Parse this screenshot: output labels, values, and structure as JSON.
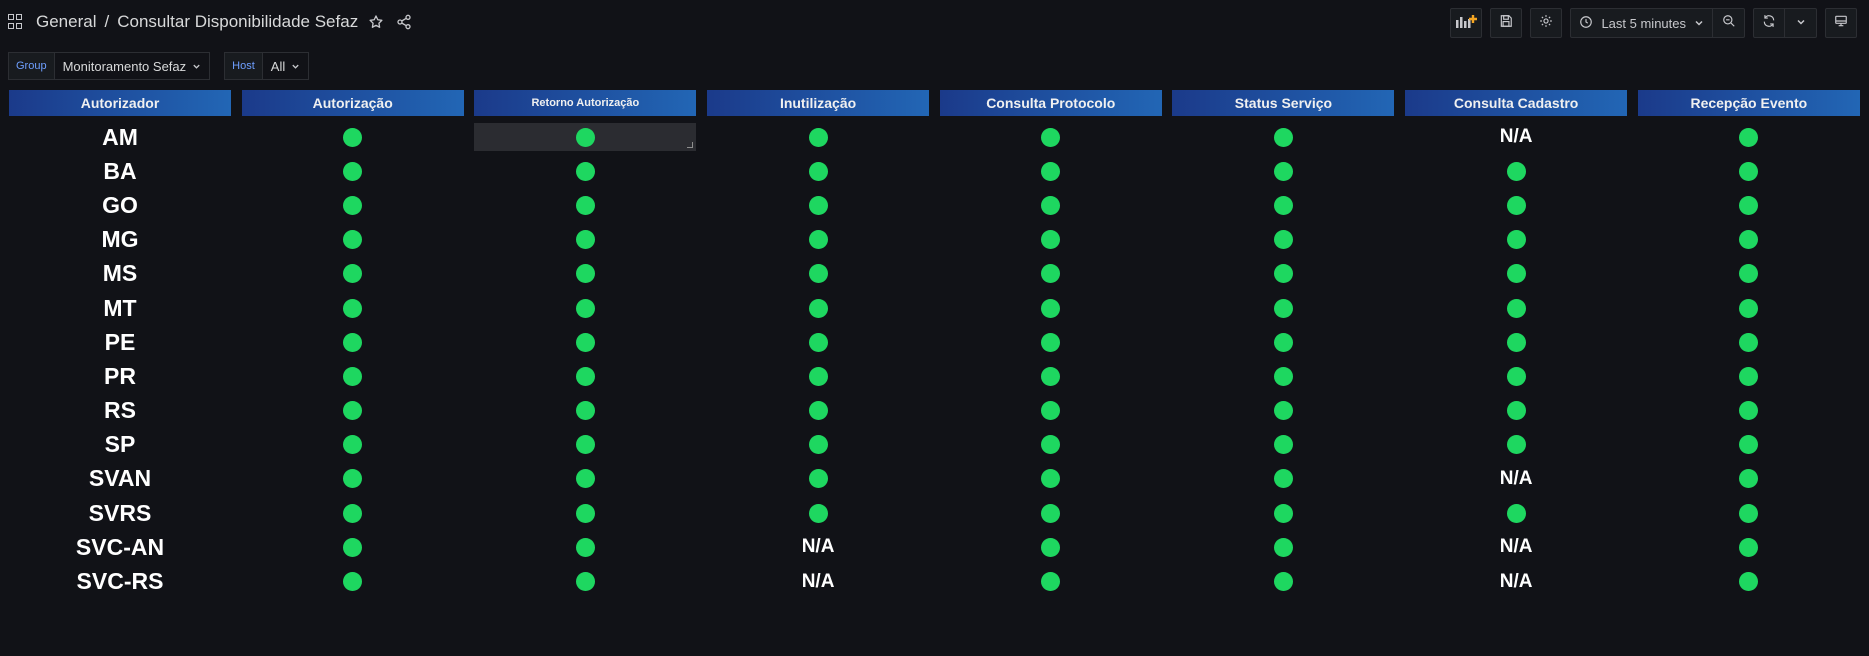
{
  "breadcrumb": {
    "folder": "General",
    "separator": "/",
    "title": "Consultar Disponibilidade Sefaz"
  },
  "toolbar": {
    "time_range": "Last 5 minutes"
  },
  "variables": [
    {
      "label": "Group",
      "value": "Monitoramento Sefaz"
    },
    {
      "label": "Host",
      "value": "All"
    }
  ],
  "colors": {
    "ok": "#1ed760",
    "header_start": "#1b3a8a",
    "header_end": "#2266b5",
    "background": "#111217"
  },
  "table": {
    "columns": [
      "Autorizador",
      "Autorização",
      "Retorno Autorização",
      "Inutilização",
      "Consulta Protocolo",
      "Status Serviço",
      "Consulta Cadastro",
      "Recepção Evento"
    ],
    "rows": [
      {
        "name": "AM",
        "values": [
          "ok",
          "ok",
          "ok",
          "ok",
          "ok",
          "N/A",
          "ok"
        ]
      },
      {
        "name": "BA",
        "values": [
          "ok",
          "ok",
          "ok",
          "ok",
          "ok",
          "ok",
          "ok"
        ]
      },
      {
        "name": "GO",
        "values": [
          "ok",
          "ok",
          "ok",
          "ok",
          "ok",
          "ok",
          "ok"
        ]
      },
      {
        "name": "MG",
        "values": [
          "ok",
          "ok",
          "ok",
          "ok",
          "ok",
          "ok",
          "ok"
        ]
      },
      {
        "name": "MS",
        "values": [
          "ok",
          "ok",
          "ok",
          "ok",
          "ok",
          "ok",
          "ok"
        ]
      },
      {
        "name": "MT",
        "values": [
          "ok",
          "ok",
          "ok",
          "ok",
          "ok",
          "ok",
          "ok"
        ]
      },
      {
        "name": "PE",
        "values": [
          "ok",
          "ok",
          "ok",
          "ok",
          "ok",
          "ok",
          "ok"
        ]
      },
      {
        "name": "PR",
        "values": [
          "ok",
          "ok",
          "ok",
          "ok",
          "ok",
          "ok",
          "ok"
        ]
      },
      {
        "name": "RS",
        "values": [
          "ok",
          "ok",
          "ok",
          "ok",
          "ok",
          "ok",
          "ok"
        ]
      },
      {
        "name": "SP",
        "values": [
          "ok",
          "ok",
          "ok",
          "ok",
          "ok",
          "ok",
          "ok"
        ]
      },
      {
        "name": "SVAN",
        "values": [
          "ok",
          "ok",
          "ok",
          "ok",
          "ok",
          "N/A",
          "ok"
        ]
      },
      {
        "name": "SVRS",
        "values": [
          "ok",
          "ok",
          "ok",
          "ok",
          "ok",
          "ok",
          "ok"
        ]
      },
      {
        "name": "SVC-AN",
        "values": [
          "ok",
          "ok",
          "N/A",
          "ok",
          "ok",
          "N/A",
          "ok"
        ]
      },
      {
        "name": "SVC-RS",
        "values": [
          "ok",
          "ok",
          "N/A",
          "ok",
          "ok",
          "N/A",
          "ok"
        ]
      }
    ]
  }
}
